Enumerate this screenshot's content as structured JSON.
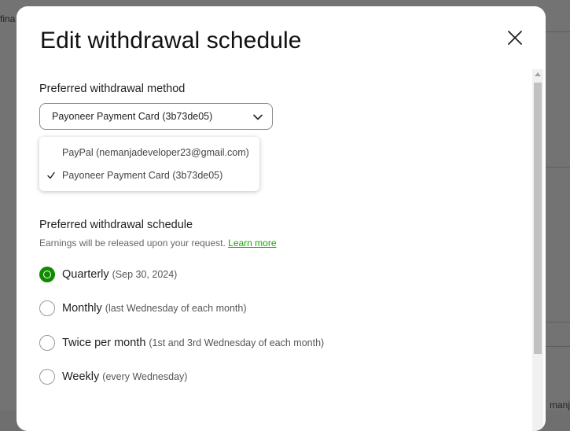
{
  "background": {
    "top_text": "fina",
    "bottom_text": "manja",
    "glyph": "l"
  },
  "modal": {
    "title": "Edit withdrawal schedule",
    "close_icon": "close-icon"
  },
  "method": {
    "label": "Preferred withdrawal method",
    "selected": "Payoneer Payment Card (3b73de05)",
    "options": [
      {
        "label": "PayPal (nemanjadeveloper23@gmail.com)",
        "checked": false
      },
      {
        "label": "Payoneer Payment Card (3b73de05)",
        "checked": true
      }
    ]
  },
  "schedule": {
    "label": "Preferred withdrawal schedule",
    "hint": "Earnings will be released upon your request.",
    "learn_more": "Learn more",
    "options": [
      {
        "main": "Quarterly",
        "sub": "(Sep 30, 2024)",
        "checked": true
      },
      {
        "main": "Monthly",
        "sub": "(last Wednesday of each month)",
        "checked": false
      },
      {
        "main": "Twice per month",
        "sub": "(1st and 3rd Wednesday of each month)",
        "checked": false
      },
      {
        "main": "Weekly",
        "sub": "(every Wednesday)",
        "checked": false
      }
    ]
  },
  "colors": {
    "accent": "#108a00",
    "link": "#14a800",
    "overlay": "#737373"
  }
}
